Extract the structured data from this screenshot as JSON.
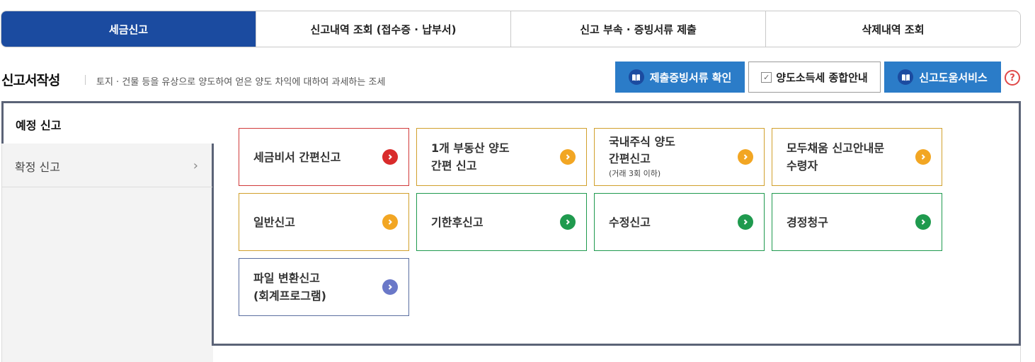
{
  "tabs": [
    {
      "label": "세금신고",
      "active": true
    },
    {
      "label": "신고내역 조회 (접수증 · 납부서)",
      "active": false
    },
    {
      "label": "신고 부속 · 증빙서류 제출",
      "active": false
    },
    {
      "label": "삭제내역 조회",
      "active": false
    }
  ],
  "header": {
    "title": "신고서작성",
    "subtitle": "토지 · 건물 등을 유상으로 양도하여 얻은 양도 차익에 대하여 과세하는 조세",
    "buttons": {
      "evidence": "제출증빙서류 확인",
      "guide": "양도소득세 종합안내",
      "help_service": "신고도움서비스"
    },
    "help_symbol": "?"
  },
  "menu": {
    "active": "예정 신고",
    "item2": "확정 신고"
  },
  "cards": {
    "c1": {
      "line1": "세금비서 간편신고"
    },
    "c2": {
      "line1": "1개 부동산 양도",
      "line2": "간편 신고"
    },
    "c3": {
      "line1": "국내주식 양도",
      "line2": "간편신고",
      "note": "(거래 3회 이하)"
    },
    "c4": {
      "line1": "모두채움 신고안내문",
      "line2": "수령자"
    },
    "c5": {
      "line1": "일반신고"
    },
    "c6": {
      "line1": "기한후신고"
    },
    "c7": {
      "line1": "수정신고"
    },
    "c8": {
      "line1": "경정청구"
    },
    "c9": {
      "line1": "파일 변환신고",
      "line2": "(회계프로그램)"
    }
  },
  "colors": {
    "primary": "#1b4ba0",
    "button_blue": "#2b7cc8",
    "red": "#d13a3a",
    "yellow": "#f2a623",
    "green": "#1f9a4e",
    "purple": "#6a78c8"
  }
}
